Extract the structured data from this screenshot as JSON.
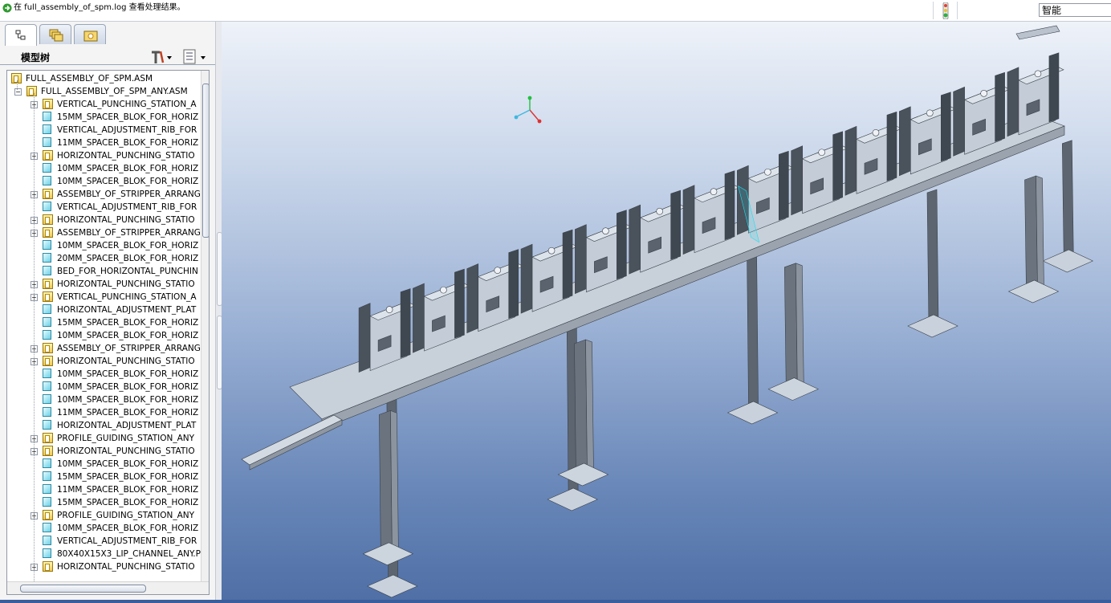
{
  "message_bar": {
    "text": "在 full_assembly_of_spm.log 查看处理结果。"
  },
  "filter": {
    "value": "智能"
  },
  "model_tree": {
    "title": "模型树",
    "tabs": [
      "model-tree-tab",
      "layers-tab",
      "favorites-tab"
    ],
    "items": [
      {
        "label": "FULL_ASSEMBLY_OF_SPM.ASM",
        "type": "asm",
        "level": 0
      },
      {
        "label": "FULL_ASSEMBLY_OF_SPM_ANY.ASM",
        "type": "asm",
        "level": 1,
        "expanded": true
      },
      {
        "label": "VERTICAL_PUNCHING_STATION_A",
        "type": "asm",
        "level": 2
      },
      {
        "label": "15MM_SPACER_BLOK_FOR_HORIZ",
        "type": "prt",
        "level": 2
      },
      {
        "label": "VERTICAL_ADJUSTMENT_RIB_FOR",
        "type": "prt",
        "level": 2
      },
      {
        "label": "11MM_SPACER_BLOK_FOR_HORIZ",
        "type": "prt",
        "level": 2
      },
      {
        "label": "HORIZONTAL_PUNCHING_STATIO",
        "type": "asm",
        "level": 2
      },
      {
        "label": "10MM_SPACER_BLOK_FOR_HORIZ",
        "type": "prt",
        "level": 2
      },
      {
        "label": "10MM_SPACER_BLOK_FOR_HORIZ",
        "type": "prt",
        "level": 2
      },
      {
        "label": "ASSEMBLY_OF_STRIPPER_ARRANG",
        "type": "asm",
        "level": 2
      },
      {
        "label": "VERTICAL_ADJUSTMENT_RIB_FOR",
        "type": "prt",
        "level": 2
      },
      {
        "label": "HORIZONTAL_PUNCHING_STATIO",
        "type": "asm",
        "level": 2
      },
      {
        "label": "ASSEMBLY_OF_STRIPPER_ARRANG",
        "type": "asm",
        "level": 2
      },
      {
        "label": "10MM_SPACER_BLOK_FOR_HORIZ",
        "type": "prt",
        "level": 2
      },
      {
        "label": "20MM_SPACER_BLOK_FOR_HORIZ",
        "type": "prt",
        "level": 2
      },
      {
        "label": "BED_FOR_HORIZONTAL_PUNCHIN",
        "type": "prt",
        "level": 2
      },
      {
        "label": "HORIZONTAL_PUNCHING_STATIO",
        "type": "asm",
        "level": 2
      },
      {
        "label": "VERTICAL_PUNCHING_STATION_A",
        "type": "asm",
        "level": 2
      },
      {
        "label": "HORIZONTAL_ADJUSTMENT_PLAT",
        "type": "prt",
        "level": 2
      },
      {
        "label": "15MM_SPACER_BLOK_FOR_HORIZ",
        "type": "prt",
        "level": 2
      },
      {
        "label": "10MM_SPACER_BLOK_FOR_HORIZ",
        "type": "prt",
        "level": 2
      },
      {
        "label": "ASSEMBLY_OF_STRIPPER_ARRANG",
        "type": "asm",
        "level": 2
      },
      {
        "label": "HORIZONTAL_PUNCHING_STATIO",
        "type": "asm",
        "level": 2
      },
      {
        "label": "10MM_SPACER_BLOK_FOR_HORIZ",
        "type": "prt",
        "level": 2
      },
      {
        "label": "10MM_SPACER_BLOK_FOR_HORIZ",
        "type": "prt",
        "level": 2
      },
      {
        "label": "10MM_SPACER_BLOK_FOR_HORIZ",
        "type": "prt",
        "level": 2
      },
      {
        "label": "11MM_SPACER_BLOK_FOR_HORIZ",
        "type": "prt",
        "level": 2
      },
      {
        "label": "HORIZONTAL_ADJUSTMENT_PLAT",
        "type": "prt",
        "level": 2
      },
      {
        "label": "PROFILE_GUIDING_STATION_ANY",
        "type": "asm",
        "level": 2
      },
      {
        "label": "HORIZONTAL_PUNCHING_STATIO",
        "type": "asm",
        "level": 2
      },
      {
        "label": "10MM_SPACER_BLOK_FOR_HORIZ",
        "type": "prt",
        "level": 2
      },
      {
        "label": "15MM_SPACER_BLOK_FOR_HORIZ",
        "type": "prt",
        "level": 2
      },
      {
        "label": "11MM_SPACER_BLOK_FOR_HORIZ",
        "type": "prt",
        "level": 2
      },
      {
        "label": "15MM_SPACER_BLOK_FOR_HORIZ",
        "type": "prt",
        "level": 2
      },
      {
        "label": "PROFILE_GUIDING_STATION_ANY",
        "type": "asm",
        "level": 2
      },
      {
        "label": "10MM_SPACER_BLOK_FOR_HORIZ",
        "type": "prt",
        "level": 2
      },
      {
        "label": "VERTICAL_ADJUSTMENT_RIB_FOR",
        "type": "prt",
        "level": 2
      },
      {
        "label": "80X40X15X3_LIP_CHANNEL_ANY.P",
        "type": "prt",
        "level": 2
      },
      {
        "label": "HORIZONTAL_PUNCHING_STATIO",
        "type": "asm",
        "level": 2
      }
    ]
  },
  "colors": {
    "viewport_top": "#eef2f9",
    "viewport_bottom": "#4f6fa6",
    "model_face": "#c8d0da",
    "model_dark": "#4a525c",
    "highlight": "#18e0f0"
  }
}
